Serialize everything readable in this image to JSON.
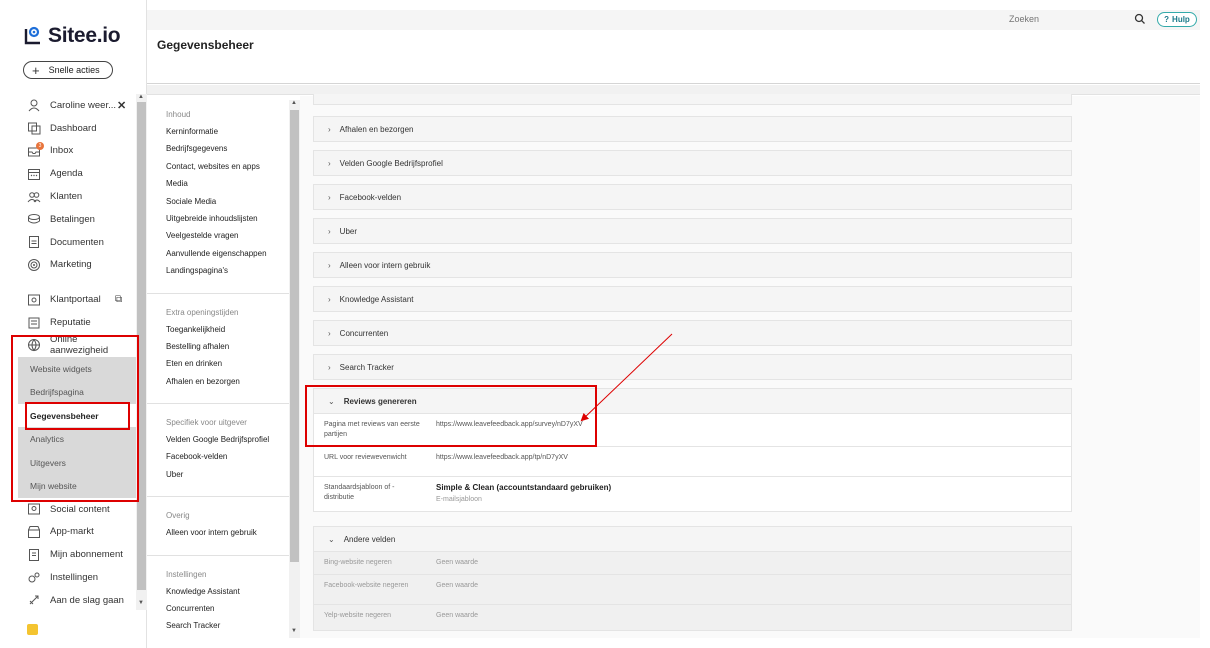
{
  "app": {
    "logo_text": "Sitee.io",
    "quick_actions": "Snelle acties"
  },
  "sidebar": {
    "items": [
      {
        "label": "Caroline weer...",
        "icon": "user-icon"
      },
      {
        "label": "Dashboard",
        "icon": "dashboard-icon"
      },
      {
        "label": "Inbox",
        "icon": "inbox-icon",
        "badge": "3"
      },
      {
        "label": "Agenda",
        "icon": "calendar-icon"
      },
      {
        "label": "Klanten",
        "icon": "users-icon"
      },
      {
        "label": "Betalingen",
        "icon": "payments-icon"
      },
      {
        "label": "Documenten",
        "icon": "document-icon"
      },
      {
        "label": "Marketing",
        "icon": "target-icon"
      },
      {
        "label": "Klantportaal",
        "icon": "portal-icon"
      },
      {
        "label": "Reputatie",
        "icon": "reputation-icon"
      },
      {
        "label": "Online aanwezigheid",
        "icon": "globe-icon"
      },
      {
        "label": "Social content",
        "icon": "social-icon"
      },
      {
        "label": "App-markt",
        "icon": "store-icon"
      },
      {
        "label": "Mijn abonnement",
        "icon": "subscription-icon"
      },
      {
        "label": "Instellingen",
        "icon": "settings-icon"
      },
      {
        "label": "Aan de slag gaan",
        "icon": "rocket-icon"
      }
    ],
    "sub_items": [
      "Website widgets",
      "Bedrijfspagina",
      "Gegevensbeheer",
      "Analytics",
      "Uitgevers",
      "Mijn website"
    ]
  },
  "topbar": {
    "search_placeholder": "Zoeken",
    "help": "Hulp"
  },
  "page": {
    "title": "Gegevensbeheer"
  },
  "content_nav": [
    {
      "heading": "Inhoud",
      "links": [
        "Kerninformatie",
        "Bedrijfsgegevens",
        "Contact, websites en apps",
        "Media",
        "Sociale Media",
        "Uitgebreide inhoudslijsten",
        "Veelgestelde vragen",
        "Aanvullende eigenschappen",
        "Landingspagina's"
      ]
    },
    {
      "heading": "Extra openingstijden",
      "links": [
        "Toegankelijkheid",
        "Bestelling afhalen",
        "Eten en drinken",
        "Afhalen en bezorgen"
      ]
    },
    {
      "heading": "Specifiek voor uitgever",
      "links": [
        "Velden Google Bedrijfsprofiel",
        "Facebook-velden",
        "Uber"
      ]
    },
    {
      "heading": "Overig",
      "links": [
        "Alleen voor intern gebruik"
      ]
    },
    {
      "heading": "Instellingen",
      "links": [
        "Knowledge Assistant",
        "Concurrenten",
        "Search Tracker"
      ]
    }
  ],
  "panels": [
    "Afhalen en bezorgen",
    "Velden Google Bedrijfsprofiel",
    "Facebook-velden",
    "Uber",
    "Alleen voor intern gebruik",
    "Knowledge Assistant",
    "Concurrenten",
    "Search Tracker"
  ],
  "reviews": {
    "title": "Reviews genereren",
    "rows": [
      {
        "label": "Pagina met reviews van eerste partijen",
        "value": "https://www.leavefeedback.app/survey/nD7yXV"
      },
      {
        "label": "URL voor reviewevenwicht",
        "value": "https://www.leavefeedback.app/tp/nD7yXV"
      },
      {
        "label": "Standaardsjabloon of -distributie",
        "value": "Simple & Clean (accountstandaard gebruiken)",
        "sub": "E-mailsjabloon"
      }
    ]
  },
  "other": {
    "title": "Andere velden",
    "rows": [
      {
        "label": "Bing-website negeren",
        "value": "Geen waarde"
      },
      {
        "label": "Facebook-website negeren",
        "value": "Geen waarde"
      },
      {
        "label": "Yelp-website negeren",
        "value": "Geen waarde"
      }
    ]
  },
  "colors": {
    "highlight": "#dd0000",
    "accent": "#1b7a8a",
    "logo_blue": "#1e6fd9"
  }
}
